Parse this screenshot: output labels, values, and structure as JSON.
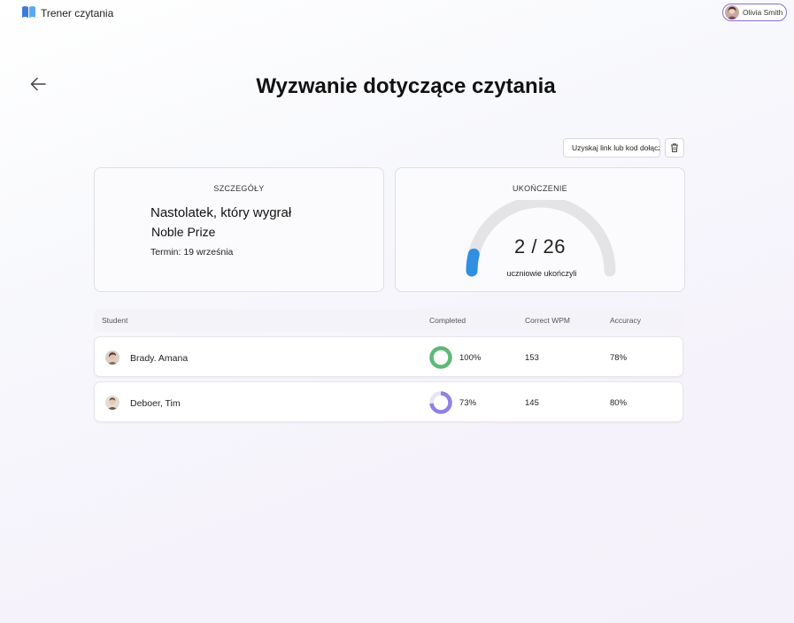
{
  "app": {
    "title": "Trener czytania"
  },
  "user": {
    "name": "Olivia Smith"
  },
  "page": {
    "title": "Wyzwanie dotyczące czytania"
  },
  "actions": {
    "share_label": "Uzyskaj link lub kod dołączania"
  },
  "details": {
    "heading": "SZCZEGÓŁY",
    "title_line1": "Nastolatek, który wygrał",
    "title_line2": "Noble Prize",
    "due": "Termin: 19 września"
  },
  "completion": {
    "heading": "UKOŃCZENIE",
    "value": "2 / 26",
    "completed": 2,
    "total": 26,
    "caption": "uczniowie ukończyli"
  },
  "table": {
    "columns": [
      "Student",
      "Completed",
      "Correct WPM",
      "Accuracy"
    ],
    "rows": [
      {
        "name": "Brady. Amana",
        "completed": "100%",
        "completed_fraction": 1.0,
        "wpm": "153",
        "accuracy": "78%"
      },
      {
        "name": "Deboer, Tim",
        "completed": "73%",
        "completed_fraction": 0.73,
        "wpm": "145",
        "accuracy": "80%"
      }
    ]
  },
  "colors": {
    "accent": "#8a6fd1",
    "gauge_fill": "#2f8fe0",
    "gauge_track": "#e4e4e6",
    "donut_green": "#5fb878",
    "donut_purple": "#8f7fe6"
  },
  "icons": {
    "logo": "book-logo-icon",
    "back": "arrow-left-icon",
    "delete": "trash-icon"
  }
}
